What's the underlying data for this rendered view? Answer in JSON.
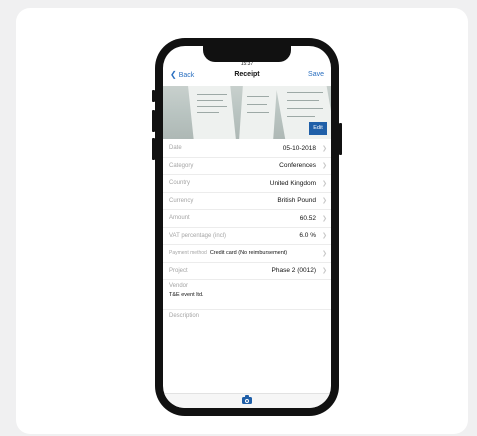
{
  "status": {
    "time": "15:37"
  },
  "nav": {
    "back": "Back",
    "title": "Receipt",
    "save": "Save"
  },
  "photo": {
    "edit": "Edit"
  },
  "fields": [
    {
      "label": "Date",
      "value": "05-10-2018"
    },
    {
      "label": "Category",
      "value": "Conferences"
    },
    {
      "label": "Country",
      "value": "United Kingdom"
    },
    {
      "label": "Currency",
      "value": "British Pound"
    },
    {
      "label": "Amount",
      "value": "60.52"
    },
    {
      "label": "VAT percentage (incl)",
      "value": "6.0 %"
    },
    {
      "label": "Payment method",
      "value": "Credit card (No reimbursement)"
    },
    {
      "label": "Project",
      "value": "Phase 2 (0012)"
    }
  ],
  "vendor": {
    "label": "Vendor",
    "value": "T&E event ltd."
  },
  "description": {
    "label": "Description"
  },
  "icons": {
    "back": "chevron-left-icon",
    "row": "chevron-right-icon",
    "camera": "camera-icon"
  },
  "colors": {
    "accent": "#2a6fc0",
    "button": "#1f5fa8"
  }
}
